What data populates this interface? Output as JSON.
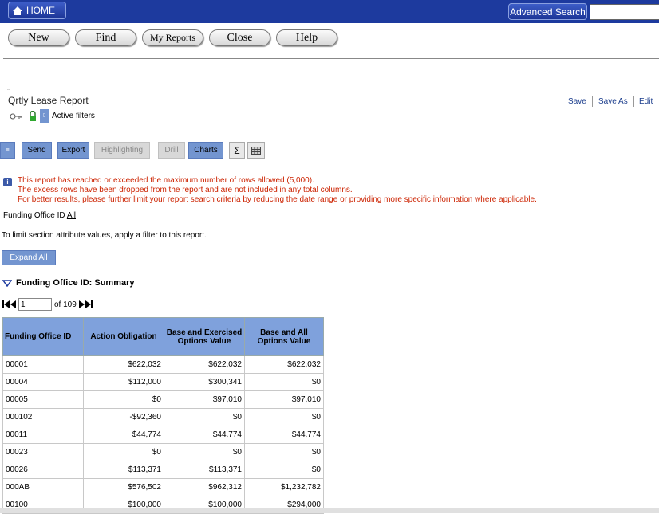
{
  "topbar": {
    "home_label": "HOME",
    "advanced_search_label": "Advanced Search",
    "search_value": ""
  },
  "nav": {
    "new": "New",
    "find": "Find",
    "my_reports": "My Reports",
    "close": "Close",
    "help": "Help"
  },
  "report": {
    "title": "Qrtly Lease Report",
    "links": {
      "save": "Save",
      "save_as": "Save As",
      "edit": "Edit"
    },
    "active_filters": "Active filters"
  },
  "toolbar": {
    "send": "Send",
    "export": "Export",
    "highlighting": "Highlighting",
    "drill": "Drill",
    "charts": "Charts",
    "sigma": "Σ"
  },
  "warning": {
    "line1": "This report has reached or exceeded the maximum number of rows allowed (5,000).",
    "line2": "The excess rows have been dropped from the report and are not included in any total columns.",
    "line3": "For better results, please further limit your report search criteria by reducing the date range or providing more specific information where applicable."
  },
  "funding_office": {
    "label": "Funding Office ID",
    "value": "All"
  },
  "limit_text": "To limit section attribute values, apply a filter to this report.",
  "expand_all": "Expand All",
  "summary_title": "Funding Office ID: Summary",
  "pager": {
    "current": "1",
    "of_text": "of 109"
  },
  "table": {
    "headers": [
      "Funding Office ID",
      "Action Obligation",
      "Base and Exercised Options Value",
      "Base and All Options Value"
    ],
    "rows": [
      [
        "00001",
        "$622,032",
        "$622,032",
        "$622,032"
      ],
      [
        "00004",
        "$112,000",
        "$300,341",
        "$0"
      ],
      [
        "00005",
        "$0",
        "$97,010",
        "$97,010"
      ],
      [
        "000102",
        "-$92,360",
        "$0",
        "$0"
      ],
      [
        "00011",
        "$44,774",
        "$44,774",
        "$44,774"
      ],
      [
        "00023",
        "$0",
        "$0",
        "$0"
      ],
      [
        "00026",
        "$113,371",
        "$113,371",
        "$0"
      ],
      [
        "000AB",
        "$576,502",
        "$962,312",
        "$1,232,782"
      ],
      [
        "00100",
        "$100,000",
        "$100,000",
        "$294,000"
      ]
    ]
  }
}
